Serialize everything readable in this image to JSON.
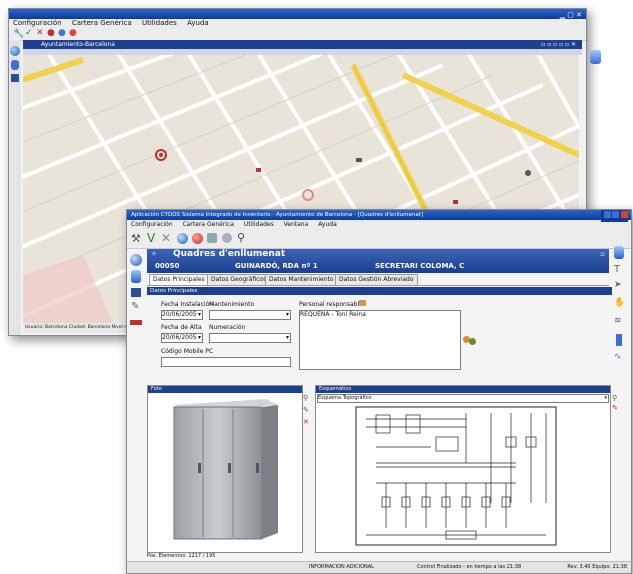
{
  "back_window": {
    "title": "",
    "menu": [
      "Configuración",
      "Cartera Genérica",
      "Utilidades",
      "Ayuda"
    ],
    "panel_title": "Ayuntamiento-Barcelona",
    "status_text": "Usuario: Barcelona    Ciudad: Barcelona    Nivel de zoom: 15"
  },
  "front_window": {
    "title": "Aplicación CYDOS Sistema Integrado de Inventario - Ayuntamiento de Barcelona - [Quadres d'enllumenat]",
    "menu": [
      "Configuración",
      "Cartera Genérica",
      "Utilidades",
      "Ventana",
      "Ayuda"
    ],
    "panel_title": "Quadres d'enllumenat",
    "record": {
      "code": "00050",
      "street": "GUINARDÓ, RDA nº 1",
      "district": "SECRETARI COLOMA, C"
    },
    "tabs": [
      "Datos Principales",
      "Datos Geográficos",
      "Datos Mantenimiento",
      "Datos Gestión Abreviado"
    ],
    "section_title": "Datos Principales",
    "fields": {
      "fecha_instalacion_label": "Fecha Instalación",
      "fecha_instalacion_value": "20/06/2005",
      "mantenimiento_label": "Mantenimiento",
      "mantenimiento_value": "",
      "fecha_alta_label": "Fecha de Alta",
      "fecha_alta_value": "20/06/2005",
      "numeracion_label": "Numeración",
      "numeracion_value": "",
      "persona_label": "Personal responsable",
      "persona_value": "REQUENA - Toni Reina",
      "codigo_label": "Código Mobile PC",
      "codigo_value": ""
    },
    "photo_panel_title": "Foto",
    "diagram_panel_title": "Esquemático",
    "diagram_select": "Esquema Topográfico",
    "footer_left": "Pos. Elementos: 1217 / 195",
    "footer_mid": "INFORMACION ADICIONAL",
    "footer_mid2": "Control Finalizado - en tiempo a las 21:38",
    "footer_right": "Rev. 3.40    Equipo: 21:38"
  },
  "colors": {
    "title_blue": "#0b3c9a",
    "panel_blue": "#1c3f8f",
    "accent_red": "#c0302b",
    "map_bg": "#e9e4da",
    "road_yellow": "#f2d24c"
  }
}
